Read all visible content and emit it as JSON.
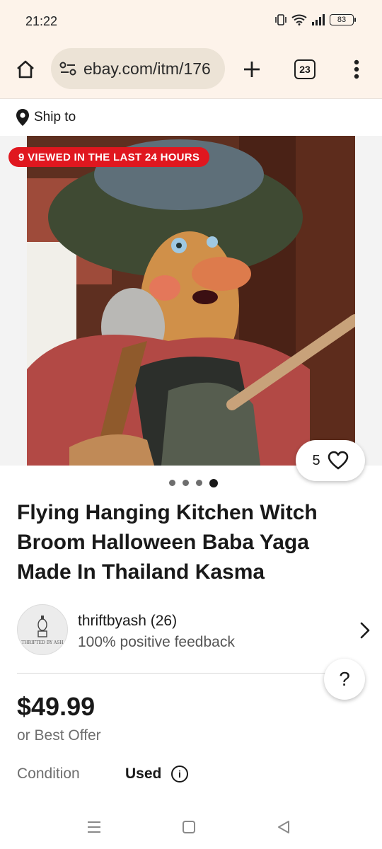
{
  "status_bar": {
    "time": "21:22",
    "battery": "83"
  },
  "browser": {
    "url": "ebay.com/itm/176",
    "tab_count": "23"
  },
  "ship": {
    "label": "Ship to"
  },
  "listing": {
    "viewed_badge": "9 VIEWED IN THE LAST 24 HOURS",
    "watch_count": "5",
    "image_index": 4,
    "image_total": 4,
    "title": "Flying Hanging Kitchen Witch Broom Halloween Baba Yaga Made In Thailand Kasma",
    "seller": {
      "name": "thriftbyash (26)",
      "feedback": "100% positive feedback",
      "avatar_text": "THRIFTED BY ASH"
    },
    "help": "?",
    "price": "$49.99",
    "offer": "or Best Offer",
    "condition_label": "Condition",
    "condition_value": "Used",
    "info_glyph": "i"
  },
  "colors": {
    "badge_red": "#e0171f",
    "toolbar_bg": "#fdf3ea",
    "url_pill": "#ece3d6"
  },
  "icons": [
    "vibrate-icon",
    "wifi-icon",
    "signal-icon",
    "battery-icon",
    "home-icon",
    "site-settings-icon",
    "plus-icon",
    "tabs-icon",
    "more-vert-icon",
    "location-pin-icon",
    "heart-icon",
    "chevron-right-icon",
    "info-icon",
    "menu-nav-icon",
    "home-nav-icon",
    "back-nav-icon"
  ]
}
